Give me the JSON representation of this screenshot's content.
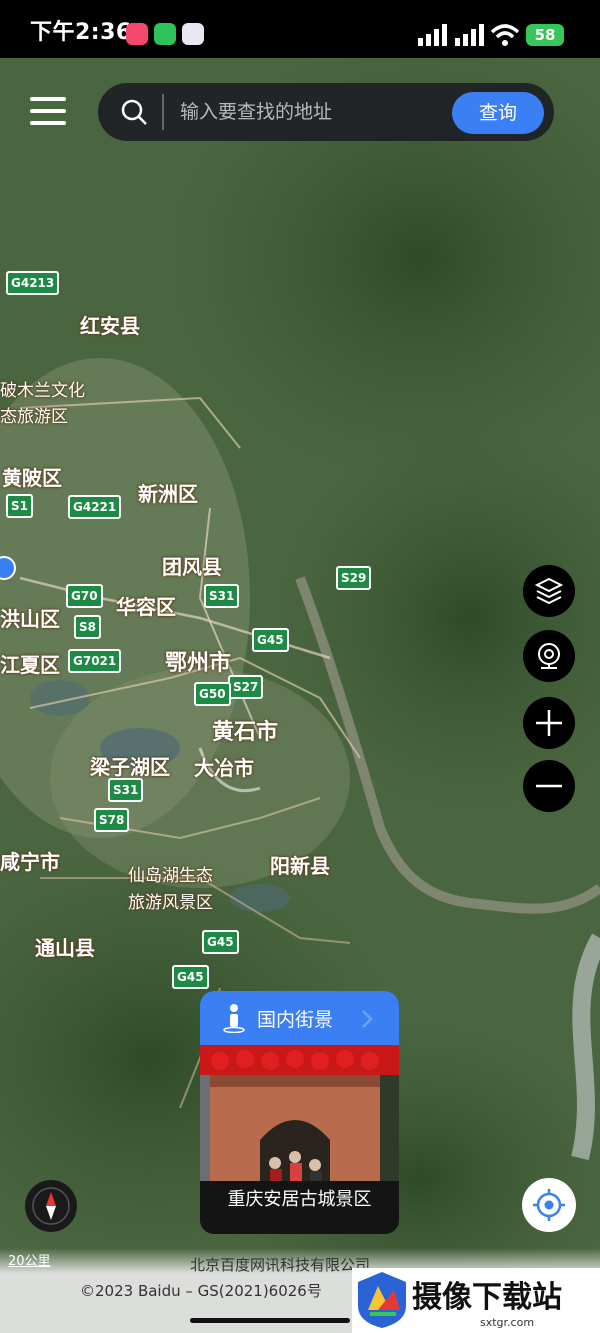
{
  "status_bar": {
    "time": "下午2:36",
    "battery": "58"
  },
  "search": {
    "placeholder": "输入要查找的地址",
    "button_label": "查询"
  },
  "map_labels": {
    "hongan": "红安县",
    "mulan_1": "破木兰文化",
    "mulan_2": "态旅游区",
    "huangpi": "黄陂区",
    "xinzhou": "新洲区",
    "tuanfeng": "团风县",
    "hongshan": "洪山区",
    "huarong": "华容区",
    "ezhou": "鄂州市",
    "jiangxia": "江夏区",
    "huangshi": "黄石市",
    "liangzihu": "梁子湖区",
    "daye": "大冶市",
    "xianning": "咸宁市",
    "xiandaohu_1": "仙岛湖生态",
    "xiandaohu_2": "旅游风景区",
    "yangxin": "阳新县",
    "tongshan": "通山县"
  },
  "road_shields": {
    "g4213": "G4213",
    "g4221": "G4221",
    "s1": "S1",
    "g70": "G70",
    "s8": "S8",
    "g7021": "G7021",
    "s31a": "S31",
    "s29": "S29",
    "g45a": "G45",
    "s27": "S27",
    "g50": "G50",
    "s31b": "S31",
    "s78": "S78",
    "g45b": "G45",
    "g45c": "G45"
  },
  "street_view": {
    "title": "国内街景",
    "caption": "重庆安居古城景区"
  },
  "map_controls": {
    "layers": "layers-icon",
    "streetview": "camera-icon",
    "zoom_in": "plus-icon",
    "zoom_out": "minus-icon"
  },
  "footer": {
    "scale": "20公里",
    "copyright_line1": "北京百度网讯科技有限公司",
    "copyright_line2": "©2023 Baidu – GS(2021)6026号"
  },
  "watermark": {
    "text": "摄像下载站",
    "url": "sxtgr.com"
  },
  "colors": {
    "accent": "#3b7ff5",
    "road_shield": "#1f8a45",
    "battery": "#35c759"
  }
}
